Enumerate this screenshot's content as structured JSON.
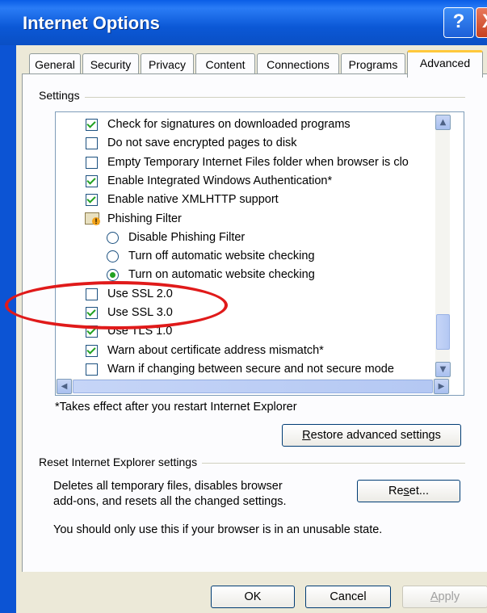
{
  "window": {
    "title": "Internet Options",
    "help_glyph": "?",
    "close_glyph": "X"
  },
  "tabs": [
    "General",
    "Security",
    "Privacy",
    "Content",
    "Connections",
    "Programs",
    "Advanced"
  ],
  "active_tab": "Advanced",
  "settings": {
    "legend": "Settings",
    "items": [
      {
        "type": "checkbox",
        "checked": true,
        "label": "Check for signatures on downloaded programs"
      },
      {
        "type": "checkbox",
        "checked": false,
        "label": "Do not save encrypted pages to disk"
      },
      {
        "type": "checkbox",
        "checked": false,
        "label": "Empty Temporary Internet Files folder when browser is clo"
      },
      {
        "type": "checkbox",
        "checked": true,
        "label": "Enable Integrated Windows Authentication*"
      },
      {
        "type": "checkbox",
        "checked": true,
        "label": "Enable native XMLHTTP support"
      },
      {
        "type": "folder",
        "label": "Phishing Filter"
      },
      {
        "type": "radio",
        "checked": false,
        "label": "Disable Phishing Filter"
      },
      {
        "type": "radio",
        "checked": false,
        "label": "Turn off automatic website checking"
      },
      {
        "type": "radio",
        "checked": true,
        "label": "Turn on automatic website checking"
      },
      {
        "type": "checkbox",
        "checked": false,
        "label": "Use SSL 2.0"
      },
      {
        "type": "checkbox",
        "checked": true,
        "label": "Use SSL 3.0"
      },
      {
        "type": "checkbox",
        "checked": true,
        "label": "Use TLS 1.0"
      },
      {
        "type": "checkbox",
        "checked": true,
        "label": "Warn about certificate address mismatch*"
      },
      {
        "type": "checkbox",
        "checked": false,
        "label": "Warn if changing between secure and not secure mode"
      }
    ],
    "footnote": "*Takes effect after you restart Internet Explorer",
    "restore_prefix": "",
    "restore_u": "R",
    "restore_rest": "estore advanced settings"
  },
  "reset": {
    "legend": "Reset Internet Explorer settings",
    "desc_line1": "Deletes all temporary files, disables browser",
    "desc_line2": "add-ons, and resets all the changed settings.",
    "button_pre": "Re",
    "button_u": "s",
    "button_post": "et...",
    "warning": "You should only use this if your browser is in an unusable state."
  },
  "footer": {
    "ok": "OK",
    "cancel": "Cancel",
    "apply_u": "A",
    "apply_rest": "pply"
  },
  "colors": {
    "title_bar": "#0a5ee6",
    "annotation": "#e01a1a",
    "check": "#21a121"
  }
}
